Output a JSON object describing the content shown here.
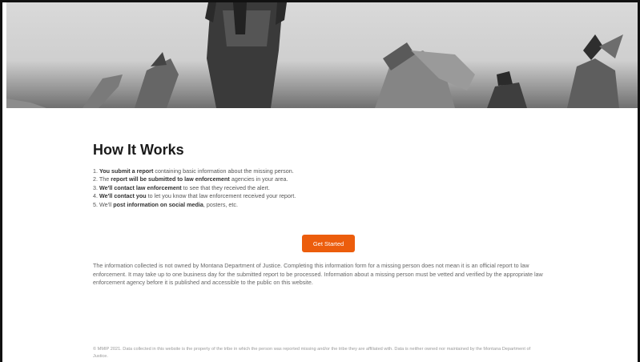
{
  "hero": {
    "image": "powwow-dancers-grayscale-photo"
  },
  "how": {
    "title": "How It Works",
    "steps": [
      {
        "num": "1.",
        "bold": "You submit a report",
        "rest": " containing basic information about the missing person."
      },
      {
        "num": "2.",
        "pre": "The ",
        "bold": "report will be submitted to law enforcement",
        "rest": " agencies in your area."
      },
      {
        "num": "3.",
        "bold": "We'll contact law enforcement",
        "rest": " to see that they received the alert."
      },
      {
        "num": "4.",
        "bold": "We'll contact you",
        "rest": " to let you know that law enforcement received your report."
      },
      {
        "num": "5.",
        "pre": "We'll ",
        "bold": "post information on social media",
        "rest": ", posters, etc."
      }
    ]
  },
  "cta": {
    "label": "Get Started",
    "color": "#ec5d0c"
  },
  "disclaimer": "The information collected is not owned by Montana Department of Justice. Completing this information form for a missing person does not mean it is an official report to law enforcement. It may take up to one business day for the submitted report to be processed. Information about a missing person must be vetted and verified by the appropriate law enforcement agency before it is published and accessible to the public on this website.",
  "footer": "© MMIP 2021. Data collected in this website is the property of the tribe in which the person was reported missing and/or the tribe they are affiliated with. Data is neither owned nor maintained by the Montana Department of Justice."
}
